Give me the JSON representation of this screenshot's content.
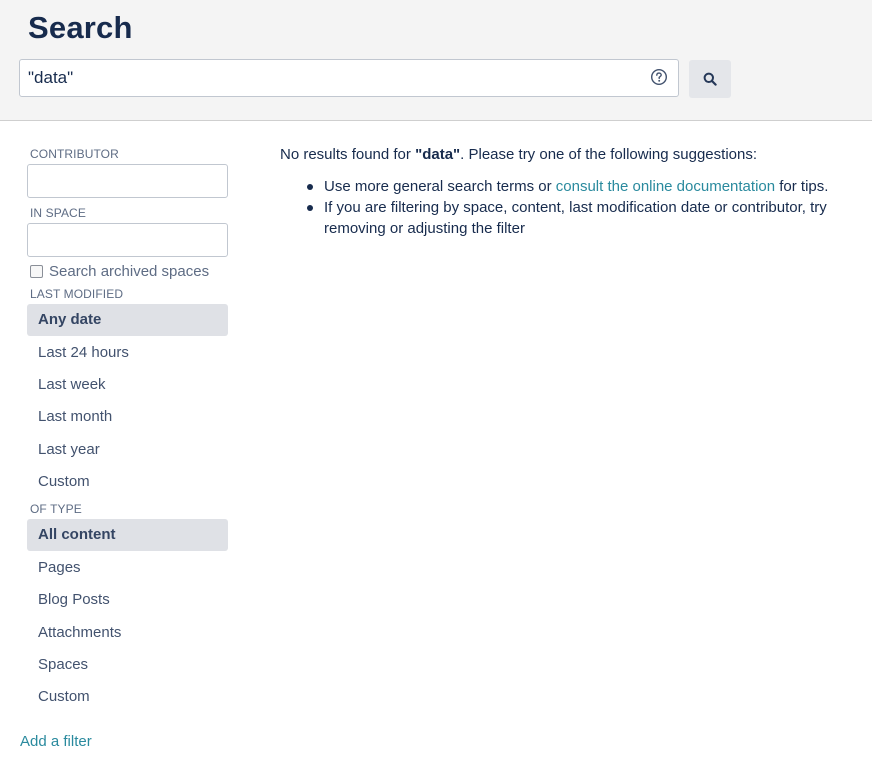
{
  "header": {
    "title": "Search",
    "search_value": "\"data\"",
    "help_icon": "question-circle-icon",
    "search_icon": "magnifier-icon"
  },
  "sidebar": {
    "contributor_label": "CONTRIBUTOR",
    "contributor_value": "",
    "in_space_label": "IN SPACE",
    "in_space_value": "",
    "archived_label": "Search archived spaces",
    "archived_checked": false,
    "last_modified_label": "LAST MODIFIED",
    "last_modified_options": [
      "Any date",
      "Last 24 hours",
      "Last week",
      "Last month",
      "Last year",
      "Custom"
    ],
    "last_modified_selected": "Any date",
    "of_type_label": "OF TYPE",
    "of_type_options": [
      "All content",
      "Pages",
      "Blog Posts",
      "Attachments",
      "Spaces",
      "Custom"
    ],
    "of_type_selected": "All content",
    "add_filter": "Add a filter"
  },
  "results": {
    "prefix": "No results found for ",
    "term": "\"data\"",
    "suffix": ". Please try one of the following suggestions:",
    "suggestion1_before": "Use more general search terms or ",
    "suggestion1_link": "consult the online documentation",
    "suggestion1_after": " for tips.",
    "suggestion2": "If you are filtering by space, content, last modification date or contributor, try removing or adjusting the filter"
  },
  "colors": {
    "header_bg": "#f4f4f4",
    "selected_bg": "#dfe1e6",
    "link": "#2a8a9e",
    "text": "#172b4d"
  }
}
